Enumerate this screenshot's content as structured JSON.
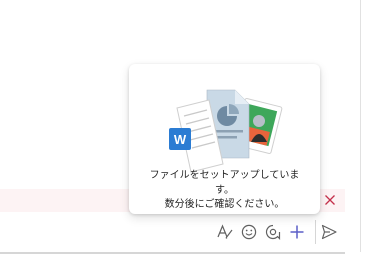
{
  "setup_popover": {
    "message_line1": "ファイルをセットアップしていま",
    "message_line2": "す。",
    "message_line3": "数分後にご確認ください。",
    "illustration_badge": "W"
  },
  "compose": {
    "icons": [
      "format-icon",
      "emoji-icon",
      "loop-icon",
      "add-icon",
      "send-icon"
    ]
  },
  "colors": {
    "accent": "#5b5fc7",
    "icon_gray": "#616161",
    "error_background": "#fdf3f4",
    "error_close": "#c4314b",
    "word_blue": "#2b7cd3"
  }
}
